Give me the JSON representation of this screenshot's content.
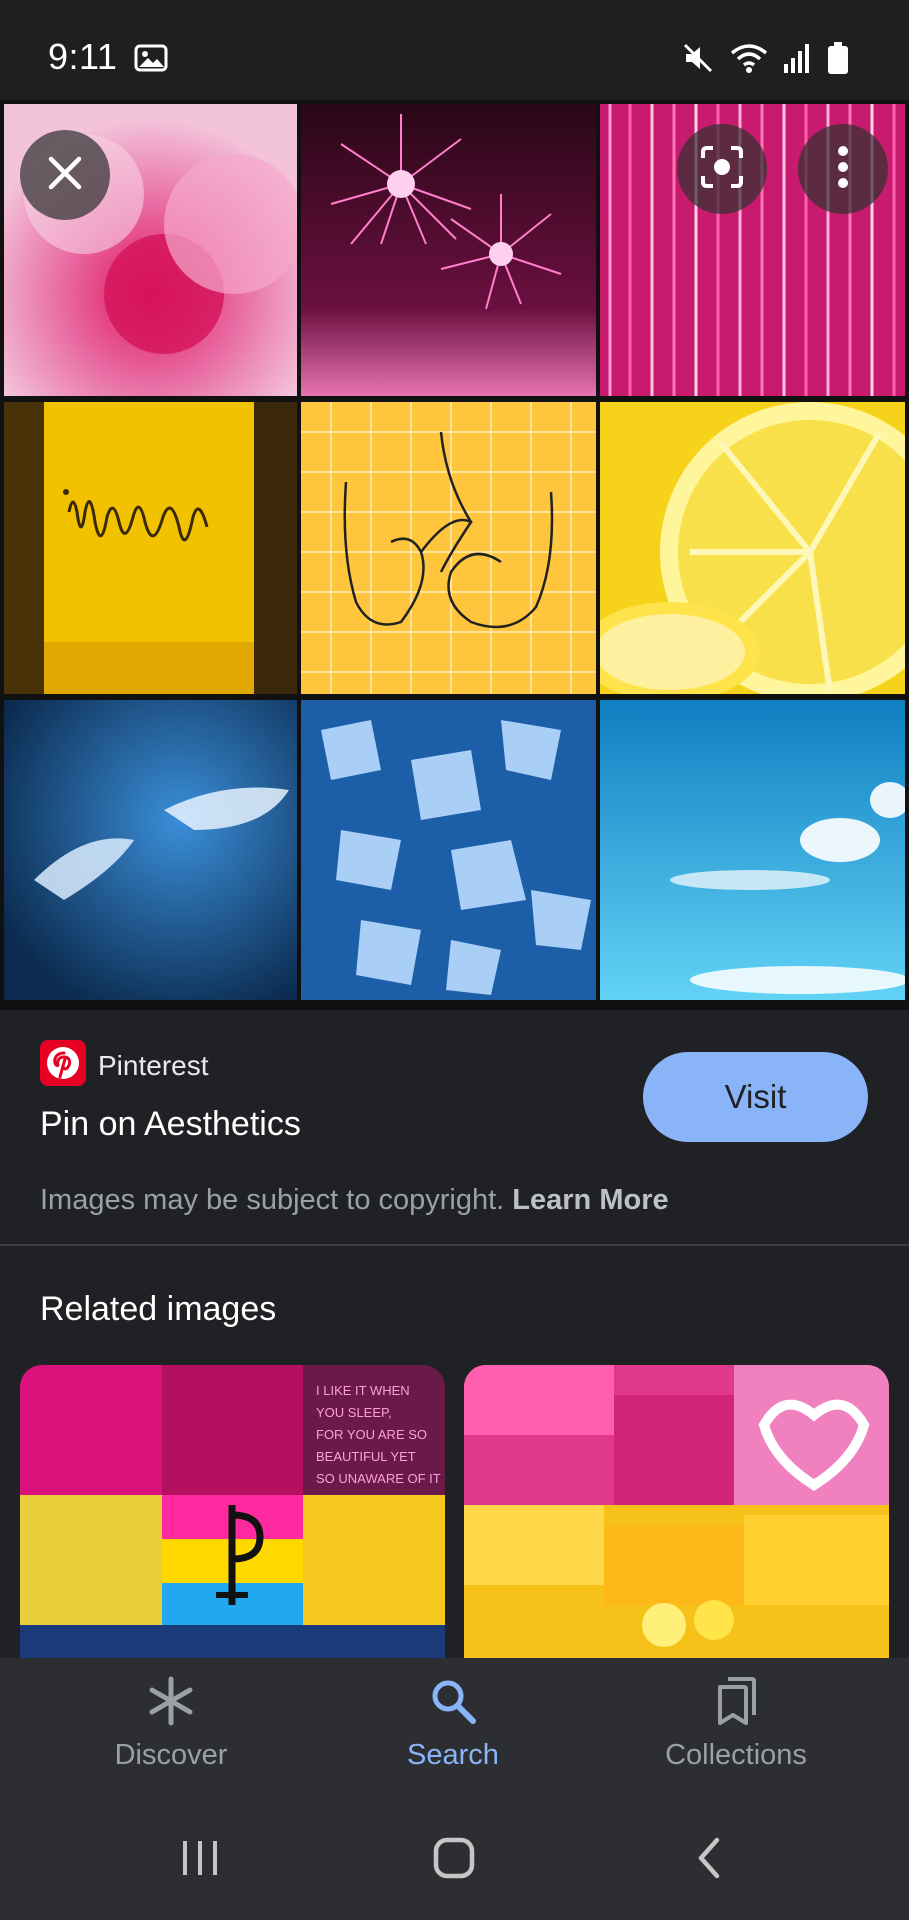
{
  "status_bar": {
    "time": "9:11",
    "icons": [
      "image-icon",
      "mute-icon",
      "wifi-icon",
      "signal-icon",
      "battery-icon"
    ]
  },
  "viewer": {
    "close_icon": "close-icon",
    "lens_icon": "lens-icon",
    "more_icon": "more-vert-icon"
  },
  "source": {
    "name": "Pinterest",
    "icon": "pinterest-logo",
    "brand_color": "#e60023"
  },
  "page_title": "Pin on Aesthetics",
  "visit_label": "Visit",
  "copyright": {
    "text": "Images may be subject to copyright.",
    "link": "Learn More"
  },
  "related_title": "Related images",
  "bottom_nav": {
    "items": [
      {
        "label": "Discover",
        "icon": "asterisk-icon",
        "active": false
      },
      {
        "label": "Search",
        "icon": "search-icon",
        "active": true
      },
      {
        "label": "Collections",
        "icon": "collections-icon",
        "active": false
      }
    ]
  },
  "system_nav": [
    "recents-icon",
    "home-icon",
    "back-icon"
  ],
  "colors": {
    "accent": "#8ab4f8",
    "background": "#202124",
    "pink": "#ff2a8c",
    "yellow": "#ffd21a",
    "blue": "#2aa9f0"
  },
  "related_images": {
    "first_text_lines": [
      "I LIKE IT WHEN",
      "YOU SLEEP,",
      "FOR YOU ARE SO",
      "BEAUTIFUL YET",
      "SO UNAWARE OF IT"
    ]
  }
}
